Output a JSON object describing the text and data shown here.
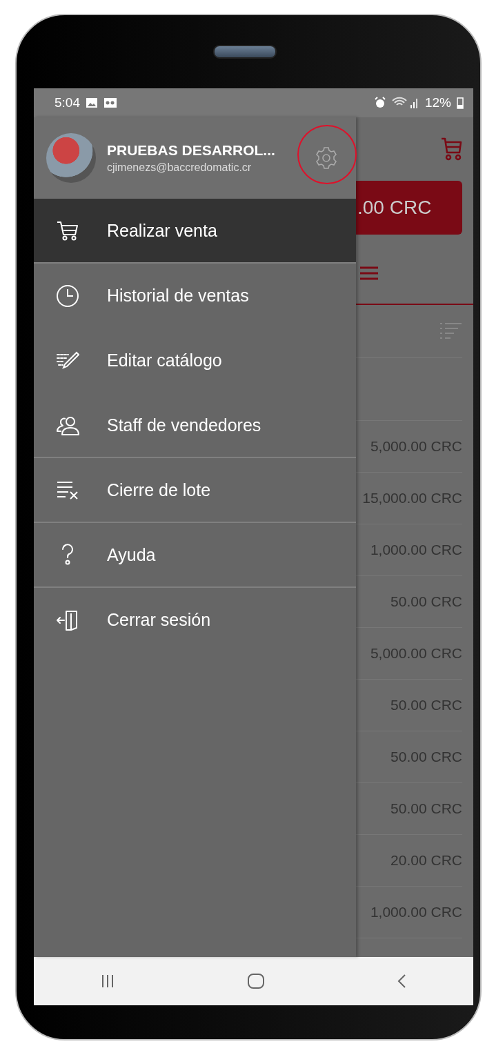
{
  "status_bar": {
    "time": "5:04",
    "battery": "12%"
  },
  "drawer": {
    "user_name": "PRUEBAS DESARROL...",
    "user_email": "cjimenezs@baccredomatic.cr",
    "settings_highlighted": true,
    "items": [
      {
        "label": "Realizar venta",
        "kind": "cart",
        "selected": true,
        "divider_after": true
      },
      {
        "label": "Historial de ventas",
        "kind": "history",
        "selected": false,
        "divider_after": false
      },
      {
        "label": "Editar catálogo",
        "kind": "edit",
        "selected": false,
        "divider_after": false
      },
      {
        "label": "Staff de vendedores",
        "kind": "staff",
        "selected": false,
        "divider_after": true
      },
      {
        "label": "Cierre de lote",
        "kind": "batch",
        "selected": false,
        "divider_after": true
      },
      {
        "label": "Ayuda",
        "kind": "help",
        "selected": false,
        "divider_after": true
      },
      {
        "label": "Cerrar sesión",
        "kind": "logout",
        "selected": false,
        "divider_after": false
      }
    ]
  },
  "background": {
    "total_button": ".00 CRC",
    "amounts": [
      "5,000.00 CRC",
      "15,000.00 CRC",
      "1,000.00 CRC",
      "50.00 CRC",
      "5,000.00 CRC",
      "50.00 CRC",
      "50.00 CRC",
      "50.00 CRC",
      "20.00 CRC",
      "1,000.00 CRC"
    ]
  }
}
